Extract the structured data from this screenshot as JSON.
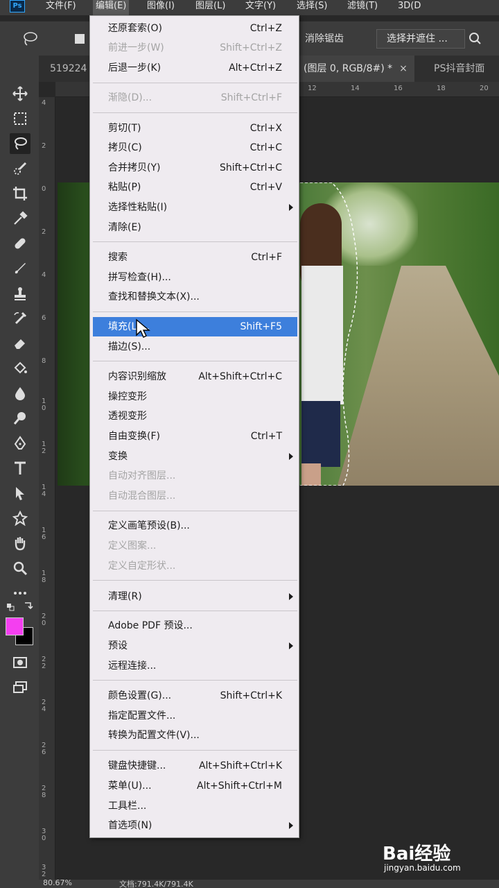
{
  "app": {
    "logo": "Ps"
  },
  "menubar": {
    "items": [
      "文件(F)",
      "编辑(E)",
      "图像(I)",
      "图层(L)",
      "文字(Y)",
      "选择(S)",
      "滤镜(T)",
      "3D(D"
    ]
  },
  "options": {
    "antialias": "消除锯齿",
    "select_mask": "选择并遮住 ..."
  },
  "tabs": [
    {
      "label": "519224"
    },
    {
      "label": "(图层 0, RGB/8#) *",
      "close": "×"
    },
    {
      "label": "PS抖音封面"
    }
  ],
  "rulers": {
    "top": [
      "12",
      "14",
      "16",
      "18",
      "20"
    ],
    "left": [
      "4",
      "2",
      "0",
      "2",
      "4",
      "6",
      "8",
      "10",
      "12",
      "14",
      "16",
      "18",
      "20",
      "22",
      "24",
      "26",
      "28",
      "30",
      "32"
    ]
  },
  "status": {
    "zoom": "80.67%",
    "doc": "文档:791.4K/791.4K"
  },
  "colors": {
    "foreground": "#f43ff0",
    "background": "#000000",
    "highlight": "#3d7fdc"
  },
  "edit_menu": {
    "items": [
      {
        "label": "还原套索(O)",
        "shortcut": "Ctrl+Z"
      },
      {
        "label": "前进一步(W)",
        "shortcut": "Shift+Ctrl+Z",
        "disabled": true
      },
      {
        "label": "后退一步(K)",
        "shortcut": "Alt+Ctrl+Z"
      },
      {
        "label": "渐隐(D)...",
        "shortcut": "Shift+Ctrl+F",
        "disabled": true
      },
      {
        "label": "剪切(T)",
        "shortcut": "Ctrl+X"
      },
      {
        "label": "拷贝(C)",
        "shortcut": "Ctrl+C"
      },
      {
        "label": "合并拷贝(Y)",
        "shortcut": "Shift+Ctrl+C"
      },
      {
        "label": "粘贴(P)",
        "shortcut": "Ctrl+V"
      },
      {
        "label": "选择性粘贴(I)",
        "shortcut": "",
        "submenu": true
      },
      {
        "label": "清除(E)",
        "shortcut": ""
      },
      {
        "label": "搜索",
        "shortcut": "Ctrl+F"
      },
      {
        "label": "拼写检查(H)...",
        "shortcut": ""
      },
      {
        "label": "查找和替换文本(X)...",
        "shortcut": ""
      },
      {
        "label": "填充(L)...",
        "shortcut": "Shift+F5",
        "highlighted": true
      },
      {
        "label": "描边(S)...",
        "shortcut": ""
      },
      {
        "label": "内容识别缩放",
        "shortcut": "Alt+Shift+Ctrl+C"
      },
      {
        "label": "操控变形",
        "shortcut": ""
      },
      {
        "label": "透视变形",
        "shortcut": ""
      },
      {
        "label": "自由变换(F)",
        "shortcut": "Ctrl+T"
      },
      {
        "label": "变换",
        "shortcut": "",
        "submenu": true
      },
      {
        "label": "自动对齐图层...",
        "shortcut": "",
        "disabled": true
      },
      {
        "label": "自动混合图层...",
        "shortcut": "",
        "disabled": true
      },
      {
        "label": "定义画笔预设(B)...",
        "shortcut": ""
      },
      {
        "label": "定义图案...",
        "shortcut": "",
        "disabled": true
      },
      {
        "label": "定义自定形状...",
        "shortcut": "",
        "disabled": true
      },
      {
        "label": "清理(R)",
        "shortcut": "",
        "submenu": true
      },
      {
        "label": "Adobe PDF 预设...",
        "shortcut": ""
      },
      {
        "label": "预设",
        "shortcut": "",
        "submenu": true
      },
      {
        "label": "远程连接...",
        "shortcut": ""
      },
      {
        "label": "颜色设置(G)...",
        "shortcut": "Shift+Ctrl+K"
      },
      {
        "label": "指定配置文件...",
        "shortcut": ""
      },
      {
        "label": "转换为配置文件(V)...",
        "shortcut": ""
      },
      {
        "label": "键盘快捷键...",
        "shortcut": "Alt+Shift+Ctrl+K"
      },
      {
        "label": "菜单(U)...",
        "shortcut": "Alt+Shift+Ctrl+M"
      },
      {
        "label": "工具栏...",
        "shortcut": ""
      },
      {
        "label": "首选项(N)",
        "shortcut": "",
        "submenu": true
      }
    ]
  },
  "watermark": {
    "brand": "Bai经验",
    "url": "jingyan.baidu.com"
  }
}
